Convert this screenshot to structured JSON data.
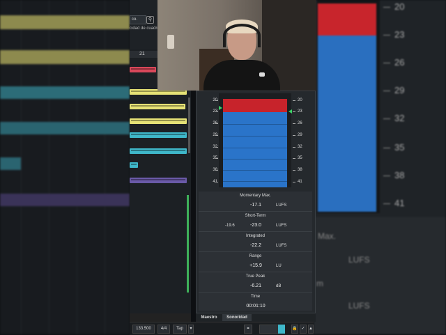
{
  "colors": {
    "clip_yellow": "#e6e276",
    "clip_cyan": "#3fb7c9",
    "clip_purple": "#6a5aa8",
    "clip_red": "#d9485a",
    "meter_red": "#c7232b",
    "meter_blue": "#2a74c9",
    "indicator_green": "#3cd066"
  },
  "daw": {
    "dropdown_value": "co.",
    "help_text": "cidad de cuadro",
    "ruler_label": "21",
    "tempo": "133.500",
    "signature": "4/4",
    "tap_label": "Tap"
  },
  "meter": {
    "left_scale": [
      "20",
      "23",
      "26",
      "29",
      "32",
      "35",
      "38",
      "41"
    ],
    "right_scale": [
      "20",
      "23",
      "26",
      "29",
      "32",
      "35",
      "38",
      "41"
    ],
    "level_short_term_fraction": 0.86,
    "level_momentary_fraction": 1.0
  },
  "readouts": {
    "momentary": {
      "label": "Momentary Max.",
      "value": "-17.1",
      "unit": "LUFS"
    },
    "short_term": {
      "label": "Short-Term",
      "extra": "-19.6",
      "value": "-23.0",
      "unit": "LUFS"
    },
    "integrated": {
      "label": "Integrated",
      "value": "-22.2",
      "unit": "LUFS"
    },
    "range": {
      "label": "Range",
      "value": "+15.9",
      "unit": "LU"
    },
    "true_peak": {
      "label": "True Peak",
      "value": "-6.21",
      "unit": "dB"
    },
    "time": {
      "label": "Time",
      "value": "00:01:10"
    }
  },
  "tabs": [
    {
      "label": "Maestro"
    },
    {
      "label": "Sonoridad"
    }
  ],
  "background_right": {
    "scale": [
      "20",
      "23",
      "26",
      "29",
      "32",
      "35",
      "38",
      "41"
    ],
    "text_max": "Max.",
    "text_lufs_1": "LUFS",
    "text_m": "m",
    "text_lufs_2": "LUFS"
  }
}
